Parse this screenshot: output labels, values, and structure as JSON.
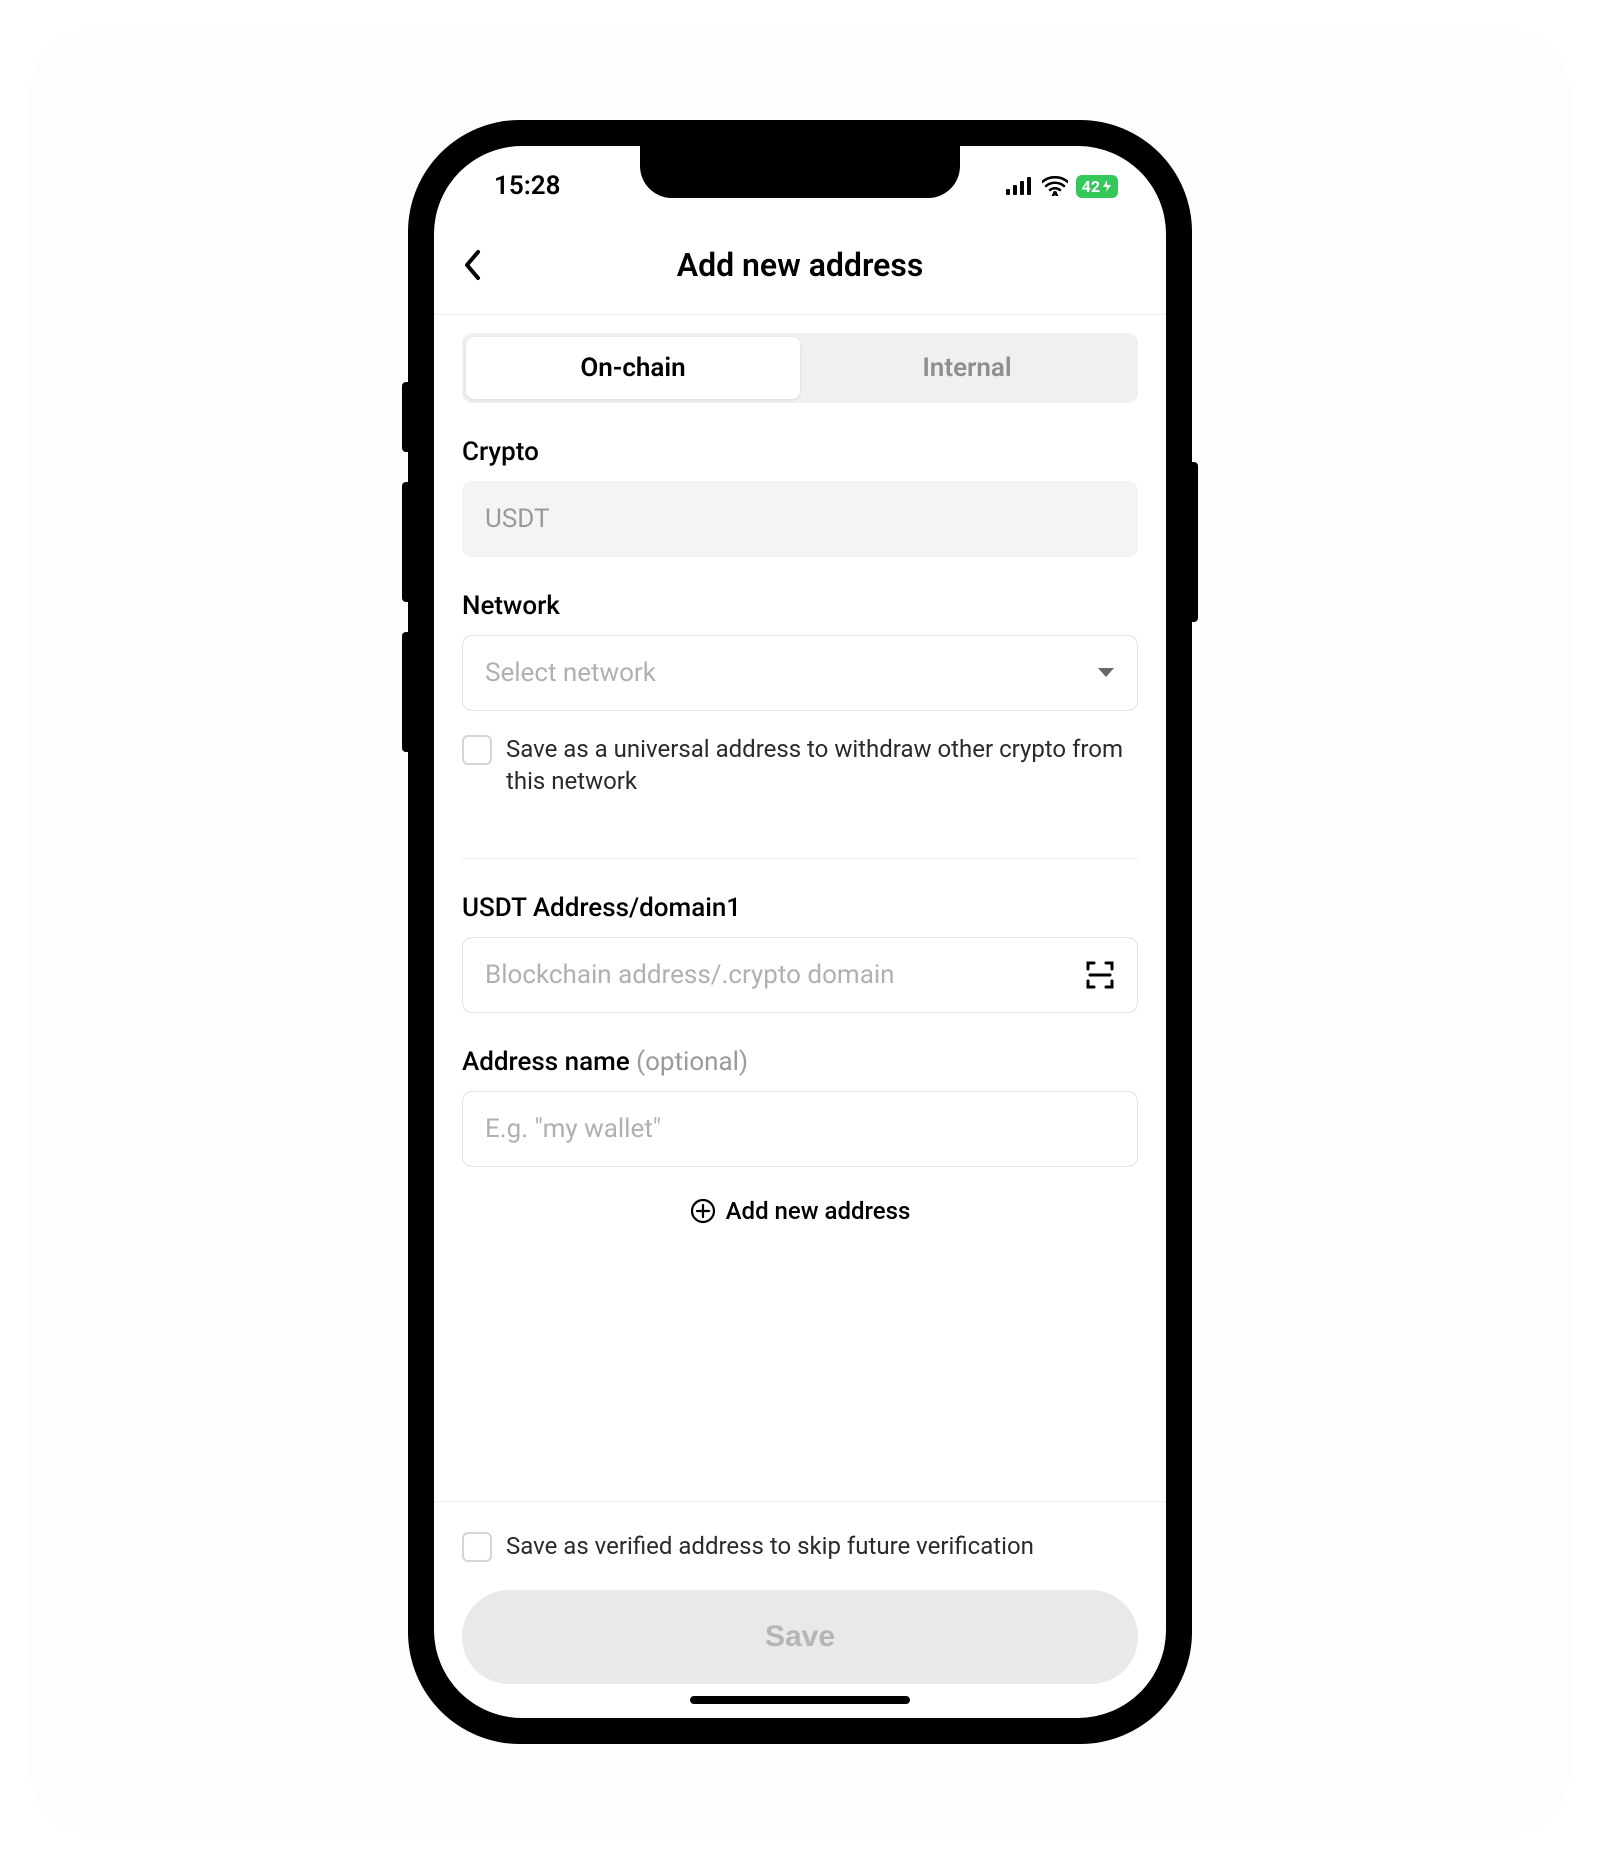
{
  "status": {
    "time": "15:28",
    "battery": "42"
  },
  "header": {
    "title": "Add new address"
  },
  "tabs": {
    "onchain": "On-chain",
    "internal": "Internal"
  },
  "crypto": {
    "label": "Crypto",
    "value": "USDT"
  },
  "network": {
    "label": "Network",
    "placeholder": "Select network",
    "universal_checkbox": "Save as a universal address to withdraw other crypto from this network"
  },
  "address": {
    "label": "USDT Address/domain1",
    "placeholder": "Blockchain address/.crypto domain"
  },
  "name": {
    "label": "Address name ",
    "optional": "(optional)",
    "placeholder": "E.g. \"my wallet\""
  },
  "add_more": "Add new address",
  "footer": {
    "verified_checkbox": "Save as verified address to skip future verification",
    "save": "Save"
  }
}
